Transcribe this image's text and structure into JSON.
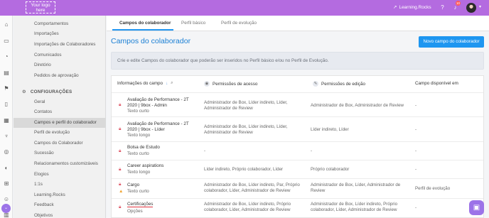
{
  "topbar": {
    "logo_text": "Your logo here",
    "brand_label": "Learning.Rocks",
    "notification_count": "10",
    "accent_color": "#b46be0"
  },
  "rail": {
    "icons": [
      "home-icon",
      "chat-icon",
      "gauge-icon",
      "document-icon",
      "flag-icon",
      "clipboard-icon",
      "chart-icon",
      "trophy-icon",
      "target-icon",
      "speedometer-icon",
      "org-chart-icon",
      "people-icon",
      "building-icon"
    ]
  },
  "subnav": {
    "items_top": [
      "Comportamentos",
      "Importações",
      "Importações de Colaboradores",
      "Comunicados",
      "Diretório",
      "Pedidos de aprovação"
    ],
    "section_title": "CONFIGURAÇÕES",
    "items_config": [
      "Geral",
      "Contatos",
      "Campos e perfil do colaborador",
      "Perfil de evolução",
      "Campos do Colaborador",
      "Sucessão",
      "Relacionamentos customizáveis",
      "Elogios",
      "1:1s",
      "Learning.Rocks",
      "Feedback",
      "Objetivos"
    ],
    "active_item": "Campos e perfil do colaborador"
  },
  "tabs": [
    "Campos do colaborador",
    "Perfil básico",
    "Perfil de evolução"
  ],
  "page": {
    "title": "Campos do colaborador",
    "new_button": "Novo campo do colaborador",
    "info_text": "Crie e edite Campos do colaborador que poderão ser inseridos no Perfil básico e/ou no Perfil de Evolução."
  },
  "table": {
    "headers": {
      "info": "Informações do campo",
      "access": "Permissões de acesso",
      "edit": "Permissões de edição",
      "available": "Campo disponível em"
    },
    "rows": [
      {
        "name": "Avaliação de Performance - 2T 2020 | 9box - Admin",
        "type": "Texto curto",
        "access": "Administrador de Box, Líder indireto, Líder, Administrador de Review",
        "edit": "Administrador de Box, Administrador de Review",
        "available": "-"
      },
      {
        "name": "Avaliação de Performance - 2T 2020 | 9box - Líder",
        "type": "Texto longo",
        "access": "Administrador de Box, Líder indireto, Líder, Administrador de Review",
        "edit": "Líder indireto, Líder",
        "available": "-"
      },
      {
        "name": "Bolsa de Estudo",
        "type": "Texto curto",
        "access": "-",
        "edit": "-",
        "available": "-"
      },
      {
        "name": "Career aspirations",
        "type": "Texto longo",
        "access": "Líder indireto, Próprio colaborador, Líder",
        "edit": "Próprio colaborador",
        "available": "-"
      },
      {
        "name": "Cargo",
        "type": "Texto curto",
        "access": "Administrador de Box, Líder indireto, Par, Próprio colaborador, Líder, Administrador de Review",
        "edit": "Administrador de Box, Líder, Administrador de Review",
        "available": "Perfil de evolução"
      },
      {
        "name": "Certificações",
        "type": "Opções",
        "access": "Administrador de Box, Líder indireto, Próprio colaborador, Líder, Administrador de Review",
        "edit": "Administrador de Box, Líder indireto, Próprio colaborador, Líder, Administrador de Review",
        "available": "-"
      }
    ]
  }
}
